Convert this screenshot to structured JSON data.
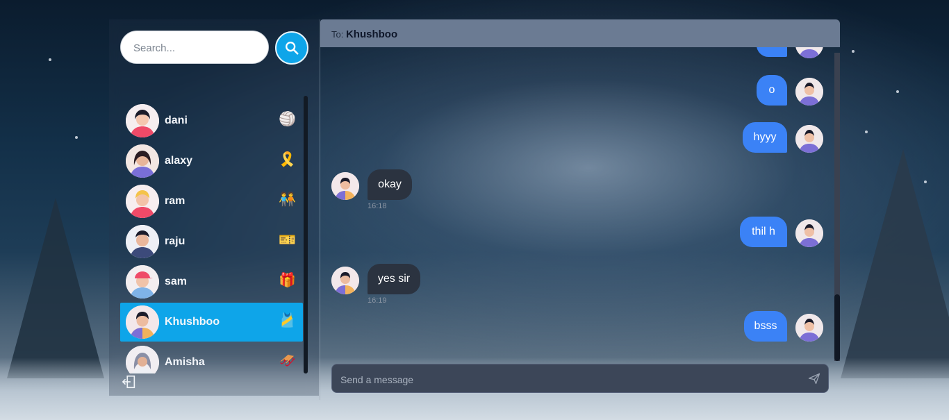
{
  "search": {
    "placeholder": "Search..."
  },
  "contacts": [
    {
      "name": "dani",
      "emoji": "🏐"
    },
    {
      "name": "alaxy",
      "emoji": "🎗️"
    },
    {
      "name": "ram",
      "emoji": "🧑‍🤝‍🧑"
    },
    {
      "name": "raju",
      "emoji": "🎫"
    },
    {
      "name": "sam",
      "emoji": "🎁"
    },
    {
      "name": "Khushboo",
      "emoji": "🎽"
    },
    {
      "name": "Amisha",
      "emoji": "🛷"
    }
  ],
  "selected_contact": "Khushboo",
  "chat": {
    "to_label": "To:",
    "recipient": "Khushboo",
    "messages": [
      {
        "dir": "out",
        "text": "o"
      },
      {
        "dir": "out",
        "text": "hyyy"
      },
      {
        "dir": "in",
        "text": "okay",
        "time": "16:18"
      },
      {
        "dir": "out",
        "text": "thil h"
      },
      {
        "dir": "in",
        "text": "yes sir",
        "time": "16:19"
      },
      {
        "dir": "out",
        "text": "bsss"
      }
    ]
  },
  "composer": {
    "placeholder": "Send a message"
  },
  "colors": {
    "accent": "#0ea5e9",
    "outgoing_bubble": "#3b82f6",
    "incoming_bubble": "#2b3340",
    "header": "#6b7b93"
  }
}
